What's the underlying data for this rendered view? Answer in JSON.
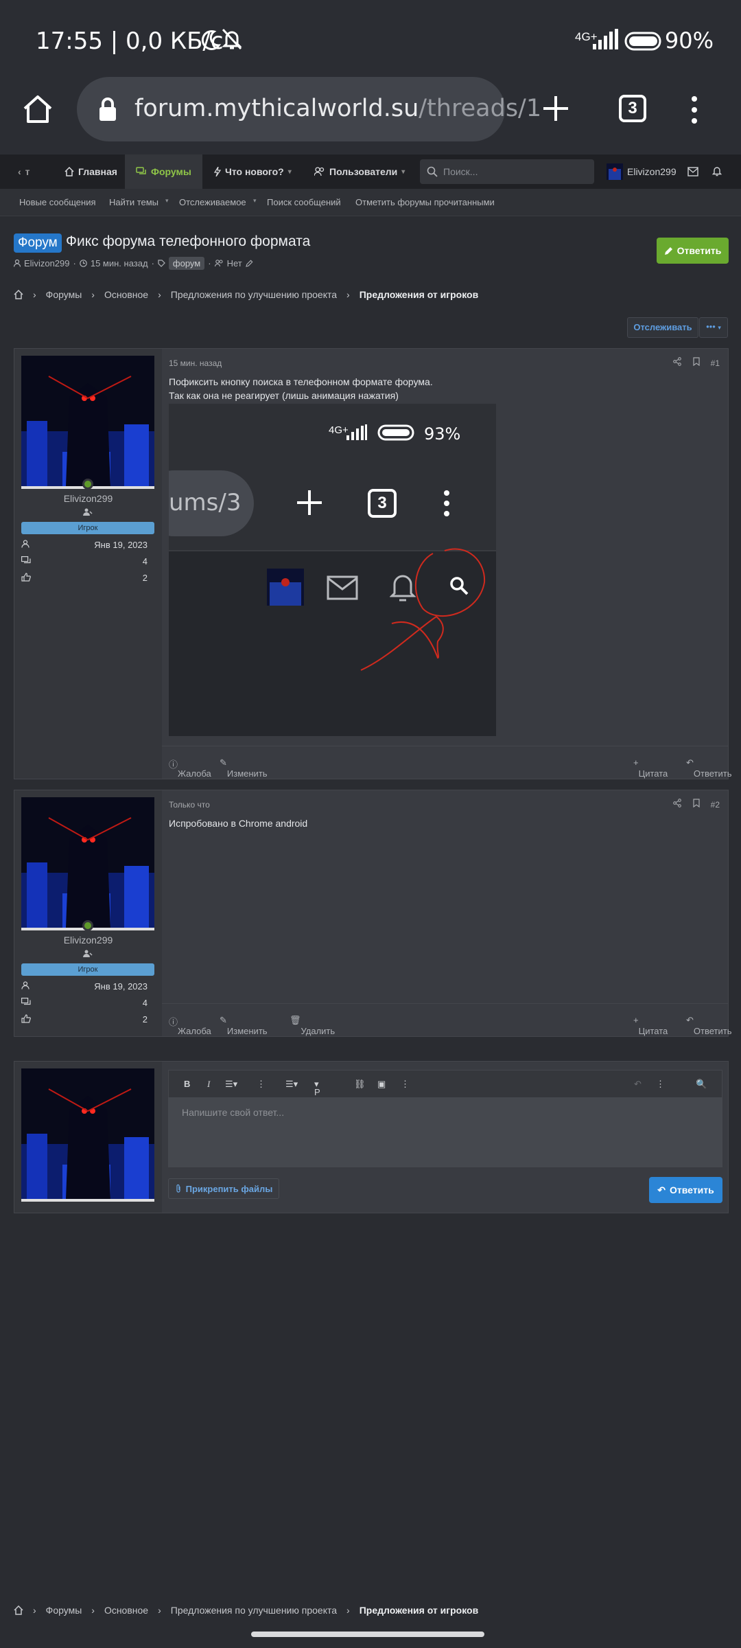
{
  "status": {
    "time": "17:55 | 0,0 КБ/с",
    "network": "4G+",
    "battery": "90%"
  },
  "browser": {
    "url_host": "forum.mythicalworld.su",
    "url_path": "/threads/1",
    "tab_count": "3"
  },
  "nav": {
    "back_label": "т",
    "items": [
      {
        "label": "Главная"
      },
      {
        "label": "Форумы"
      },
      {
        "label": "Что нового?"
      },
      {
        "label": "Пользователи"
      }
    ],
    "search_placeholder": "Поиск...",
    "username": "Elivizon299"
  },
  "subnav": [
    "Новые сообщения",
    "Найти темы",
    "Отслеживаемое",
    "Поиск сообщений",
    "Отметить форумы прочитанными"
  ],
  "thread": {
    "prefix": "Форум",
    "title": "Фикс форума телефонного формата",
    "reply_label": "Ответить",
    "author": "Elivizon299",
    "time": "15 мин. назад",
    "tag": "форум",
    "watchers": "Нет"
  },
  "breadcrumbs": [
    "Форумы",
    "Основное",
    "Предложения по улучшению проекта",
    "Предложения от игроков"
  ],
  "watch_label": "Отслеживать",
  "more_label": "•••",
  "posts": [
    {
      "date": "15 мин. назад",
      "number": "#1",
      "text_line1": "Пофиксить кнопку поиска в телефонном формате форума.",
      "text_line2": "Так как она не реагирует (лишь анимация нажатия)",
      "username": "Elivizon299",
      "role": "Игрок",
      "joined": "Янв 19, 2023",
      "messages": "4",
      "reactions": "2",
      "report": "Жалоба",
      "edit": "Изменить",
      "quote": "Цитата",
      "reply": "Ответить",
      "screenshot": {
        "network": "4G+",
        "battery": "93%",
        "url_fragment": "ums/3",
        "tab_count": "3"
      }
    },
    {
      "date": "Только что",
      "number": "#2",
      "text_line1": "Испробовано в Chrome android",
      "username": "Elivizon299",
      "role": "Игрок",
      "joined": "Янв 19, 2023",
      "messages": "4",
      "reactions": "2",
      "report": "Жалоба",
      "edit": "Изменить",
      "delete": "Удалить",
      "quote": "Цитата",
      "reply": "Ответить"
    }
  ],
  "editor": {
    "placeholder": "Напишите свой ответ...",
    "attach_label": "Прикрепить файлы",
    "submit_label": "Ответить",
    "toolbar_p": "P"
  },
  "colors": {
    "accent_green": "#8fc548",
    "button_green": "#6aaa2f",
    "link_blue": "#5e9de0",
    "prefix_blue": "#2577c9",
    "annotation_red": "#d02a1e"
  }
}
